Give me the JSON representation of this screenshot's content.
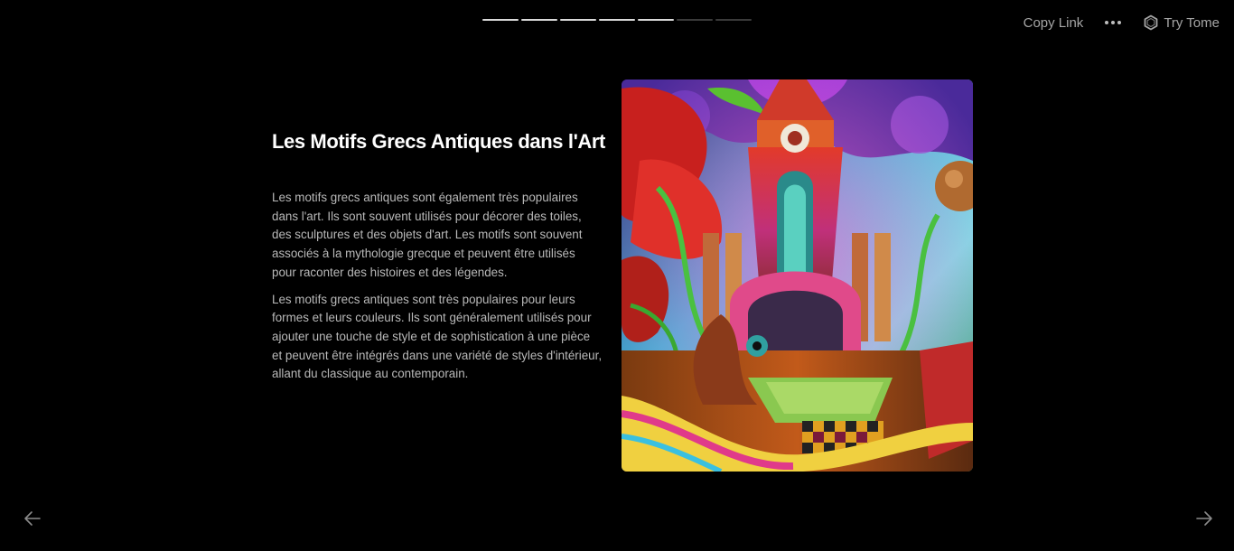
{
  "progress": {
    "total": 7,
    "completed": 5
  },
  "topbar": {
    "copy_link_label": "Copy Link",
    "more_icon": "more-horizontal-icon",
    "try_tome_label": "Try Tome",
    "tome_icon": "tome-logo-icon"
  },
  "slide": {
    "title": "Les Motifs Grecs Antiques dans l'Art",
    "paragraphs": [
      "Les motifs grecs antiques sont également très populaires dans l'art. Ils sont souvent utilisés pour décorer des toiles, des sculptures et des objets d'art. Les motifs sont souvent associés à la mythologie grecque et peuvent être utilisés pour raconter des histoires et des légendes.",
      "Les motifs grecs antiques sont très populaires pour leurs formes et leurs couleurs. Ils sont généralement utilisés pour ajouter une touche de style et de sophistication à une pièce et peuvent être intégrés dans une variété de styles d'intérieur, allant du classique au contemporain."
    ],
    "image_icon": "psychedelic-temple-artwork"
  },
  "navigation": {
    "prev_icon": "arrow-left-icon",
    "next_icon": "arrow-right-icon"
  },
  "colors": {
    "background": "#000000",
    "title": "#ffffff",
    "body_text": "#b9b9b9",
    "muted_ui": "#a6a6a6",
    "progress_done": "#d9d9d9",
    "progress_pending": "#3a3a3a"
  }
}
